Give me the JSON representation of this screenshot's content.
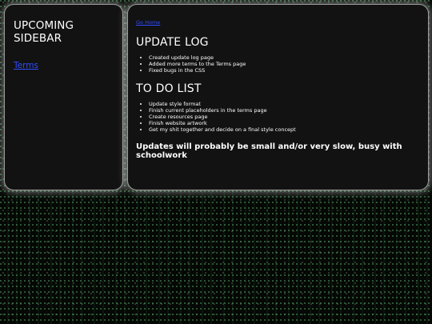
{
  "sidebar": {
    "title": "UPCOMING SIDEBAR",
    "link_label": "Terms"
  },
  "main": {
    "nav_link": "Go Home",
    "update_log": {
      "heading": "UPDATE LOG",
      "items": [
        "Created update log page",
        "Added more terms to the Terms page",
        "Fixed bugs in the CSS"
      ]
    },
    "todo": {
      "heading": "TO DO LIST",
      "items": [
        "Update style format",
        "Finish current placeholders in the terms page",
        "Create resources page",
        "Finish website artwork",
        "Get my shit together and decide on a final style concept"
      ]
    },
    "note": "Updates will probably be small and/or very slow, busy with schoolwork"
  },
  "colors": {
    "panel_bg": "#121212",
    "link": "#2f4dff",
    "background": "#050805",
    "matrix_green": "#78dc8c"
  }
}
